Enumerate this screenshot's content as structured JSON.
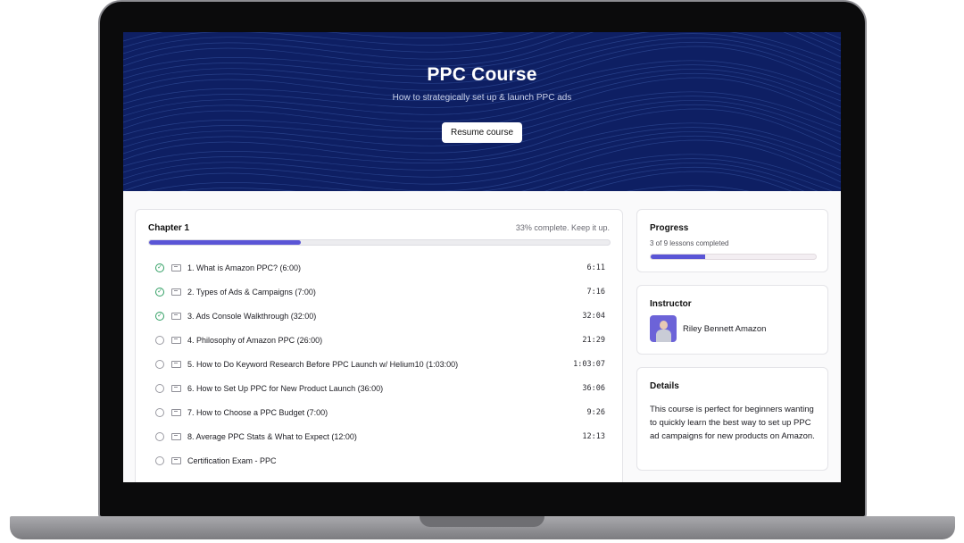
{
  "hero": {
    "title": "PPC Course",
    "subtitle": "How to strategically set up & launch PPC ads",
    "resume_label": "Resume course"
  },
  "chapter": {
    "title": "Chapter 1",
    "status": "33% complete. Keep it up.",
    "progress": 0.33,
    "lessons": [
      {
        "title": "1. What is Amazon PPC? (6:00)",
        "duration": "6:11",
        "completed": true,
        "icon": "video-icon"
      },
      {
        "title": "2. Types of Ads & Campaigns (7:00)",
        "duration": "7:16",
        "completed": true,
        "icon": "video-icon"
      },
      {
        "title": "3. Ads Console Walkthrough (32:00)",
        "duration": "32:04",
        "completed": true,
        "icon": "video-icon"
      },
      {
        "title": "4. Philosophy of Amazon PPC (26:00)",
        "duration": "21:29",
        "completed": false,
        "icon": "video-icon"
      },
      {
        "title": "5. How to Do Keyword Research Before PPC Launch w/ Helium10 (1:03:00)",
        "duration": "1:03:07",
        "completed": false,
        "icon": "video-icon"
      },
      {
        "title": "6. How to Set Up PPC for New Product Launch (36:00)",
        "duration": "36:06",
        "completed": false,
        "icon": "video-icon"
      },
      {
        "title": "7. How to Choose a PPC Budget (7:00)",
        "duration": "9:26",
        "completed": false,
        "icon": "video-icon"
      },
      {
        "title": "8. Average PPC Stats & What to Expect (12:00)",
        "duration": "12:13",
        "completed": false,
        "icon": "video-icon"
      },
      {
        "title": "Certification Exam - PPC",
        "duration": "",
        "completed": false,
        "icon": "exam-icon"
      }
    ]
  },
  "progress": {
    "title": "Progress",
    "summary": "3 of 9 lessons completed",
    "fraction": 0.33
  },
  "instructor": {
    "title": "Instructor",
    "name": "Riley Bennett Amazon"
  },
  "details": {
    "title": "Details",
    "text": "This course is perfect for beginners wanting to quickly learn the best way to set up PPC ad campaigns for new products on Amazon."
  },
  "colors": {
    "hero_bg": "#0e1f63",
    "accent": "#5a55d6",
    "check": "#2f9e62"
  }
}
